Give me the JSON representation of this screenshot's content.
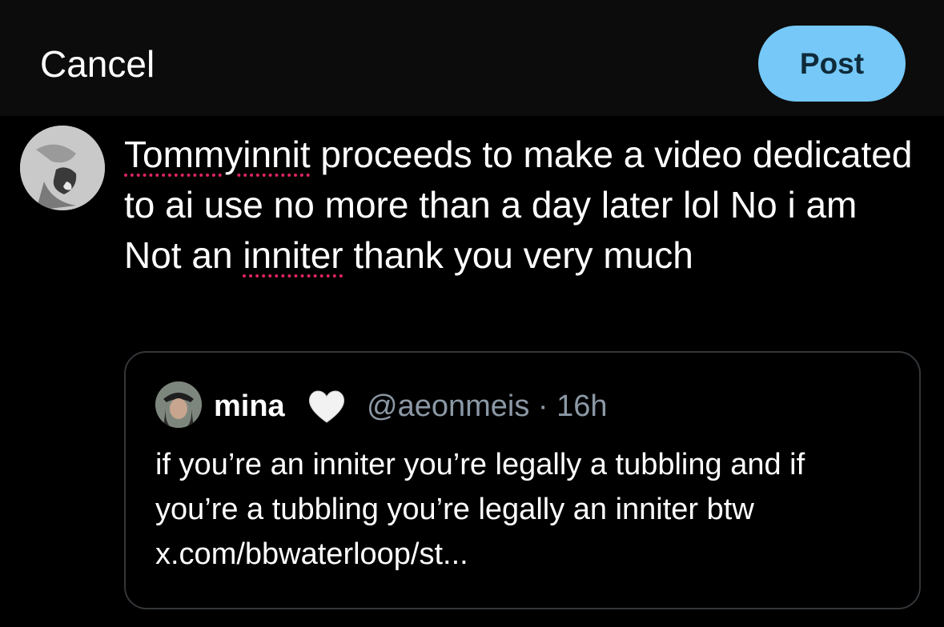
{
  "header": {
    "cancel_label": "Cancel",
    "post_label": "Post",
    "post_color": "#75c8f7"
  },
  "compose": {
    "avatar_icon": "user-avatar",
    "text_parts": {
      "word1": "Tommyinnit",
      "part2": " proceeds to make a video dedicated to ai use no more than a day later lol No i am Not an ",
      "word2": "inniter",
      "part4": " thank you very much"
    },
    "spellcheck_color": "#e0245e"
  },
  "quote": {
    "author_name": "mina",
    "emoji": "white-heart",
    "handle": "@aeonmeis",
    "separator": " · ",
    "time": "16h",
    "text": "if you’re an inniter you’re legally a tubbling and if you’re a tubbling you’re legally an inniter btw x.com/bbwaterloop/st..."
  }
}
